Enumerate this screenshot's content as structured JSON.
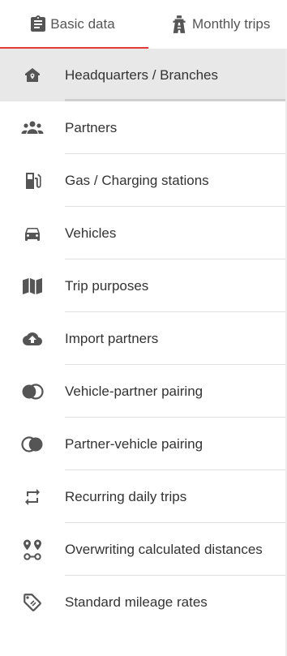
{
  "tabs": [
    {
      "label": "Basic data",
      "icon": "clipboard-icon",
      "active": true
    },
    {
      "label": "Monthly trips",
      "icon": "highway-icon",
      "active": false
    }
  ],
  "accent_color": "#e53935",
  "menu": {
    "items": [
      {
        "label": "Headquarters / Branches",
        "icon": "home-pin-icon",
        "active": true
      },
      {
        "label": "Partners",
        "icon": "people-icon"
      },
      {
        "label": "Gas / Charging stations",
        "icon": "gas-station-icon"
      },
      {
        "label": "Vehicles",
        "icon": "car-icon"
      },
      {
        "label": "Trip purposes",
        "icon": "map-book-icon"
      },
      {
        "label": "Import partners",
        "icon": "cloud-upload-icon"
      },
      {
        "label": "Vehicle-partner pairing",
        "icon": "pairing-icon"
      },
      {
        "label": "Partner-vehicle pairing",
        "icon": "pairing-reverse-icon"
      },
      {
        "label": "Recurring daily trips",
        "icon": "repeat-icon"
      },
      {
        "label": "Overwriting calculated distances",
        "icon": "route-icon"
      },
      {
        "label": "Standard mileage rates",
        "icon": "tag-icon"
      }
    ]
  }
}
